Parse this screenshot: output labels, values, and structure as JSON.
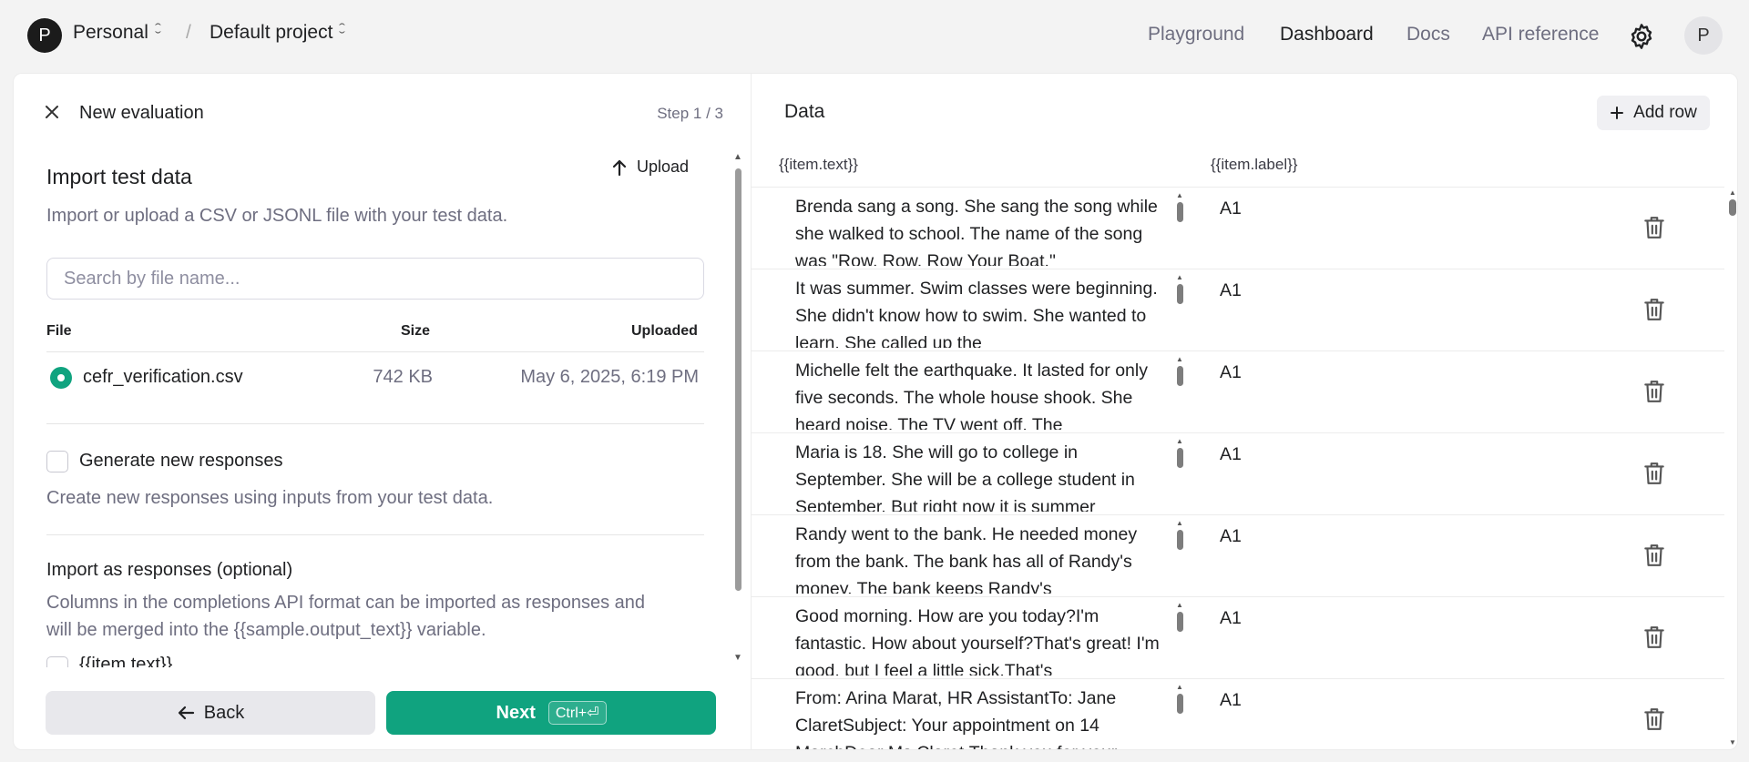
{
  "header": {
    "org_initial": "P",
    "org_name": "Personal",
    "separator": "/",
    "project_name": "Default project",
    "nav": [
      {
        "label": "Playground",
        "active": false
      },
      {
        "label": "Dashboard",
        "active": true
      },
      {
        "label": "Docs",
        "active": false
      },
      {
        "label": "API reference",
        "active": false
      }
    ],
    "user_initial": "P"
  },
  "left_panel": {
    "title": "New evaluation",
    "step": "Step 1 / 3",
    "import": {
      "title": "Import test data",
      "upload_label": "Upload",
      "description": "Import or upload a CSV or JSONL file with your test data.",
      "search_placeholder": "Search by file name...",
      "columns": {
        "file": "File",
        "size": "Size",
        "uploaded": "Uploaded"
      },
      "files": [
        {
          "name": "cefr_verification.csv",
          "size": "742 KB",
          "uploaded": "May 6, 2025, 6:19 PM",
          "selected": true
        }
      ]
    },
    "generate": {
      "label": "Generate new responses",
      "description": "Create new responses using inputs from your test data."
    },
    "import_responses": {
      "title": "Import as responses (optional)",
      "description_line1": "Columns in the completions API format can be imported as responses and",
      "description_line2": "will be merged into the {{sample.output_text}} variable.",
      "option_label": "{{item.text}}"
    },
    "buttons": {
      "back": "Back",
      "next": "Next",
      "next_shortcut": "Ctrl+⏎"
    }
  },
  "right_panel": {
    "title": "Data",
    "add_row_label": "Add row",
    "columns": [
      "{{item.text}}",
      "{{item.label}}"
    ],
    "rows": [
      {
        "text": "Brenda sang a song. She sang the song while she walked to school. The name of the song was \"Row, Row, Row Your Boat.\"",
        "label": "A1"
      },
      {
        "text": "It was summer. Swim classes were beginning. She didn't know how to swim. She wanted to learn. She called up the",
        "label": "A1"
      },
      {
        "text": "Michelle felt the earthquake. It lasted for only five seconds. The whole house shook. She heard noise. The TV went off. The",
        "label": "A1"
      },
      {
        "text": "Maria is 18. She will go to college in September. She will be a college student in September. But right now it is summer",
        "label": "A1"
      },
      {
        "text": "Randy went to the bank. He needed money from the bank. The bank has all of Randy's money. The bank keeps Randy's",
        "label": "A1"
      },
      {
        "text": "Good morning. How are you today?I'm fantastic. How about yourself?That's great! I'm good, but I feel a little sick.That's",
        "label": "A1"
      },
      {
        "text": "From: Arina Marat, HR AssistantTo: Jane ClaretSubject: Your appointment on 14 MarchDear Ms Claret,Thank you for your",
        "label": "A1"
      }
    ]
  },
  "colors": {
    "accent": "#10a37f",
    "text": "#202123",
    "muted": "#6e6e80"
  }
}
